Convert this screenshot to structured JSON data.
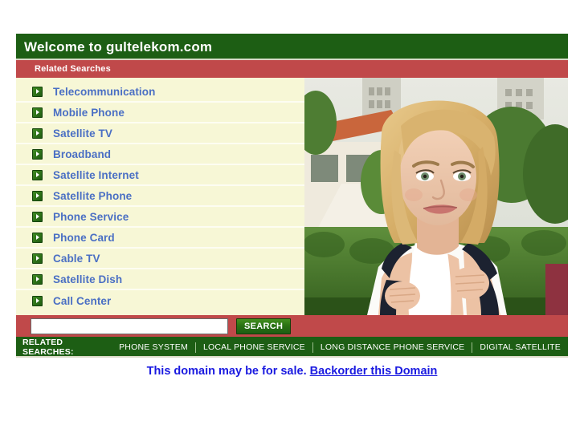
{
  "header": {
    "title": "Welcome to gultelekom.com"
  },
  "subbar": {
    "title": "Related Searches"
  },
  "related_links": [
    {
      "label": "Telecommunication",
      "icon": "arrow-right-icon"
    },
    {
      "label": "Mobile Phone",
      "icon": "arrow-right-icon"
    },
    {
      "label": "Satellite TV",
      "icon": "arrow-right-icon"
    },
    {
      "label": "Broadband",
      "icon": "arrow-right-icon"
    },
    {
      "label": "Satellite Internet",
      "icon": "arrow-right-icon"
    },
    {
      "label": "Satellite Phone",
      "icon": "arrow-right-icon"
    },
    {
      "label": "Phone Service",
      "icon": "arrow-right-icon"
    },
    {
      "label": "Phone Card",
      "icon": "arrow-right-icon"
    },
    {
      "label": "Cable TV",
      "icon": "arrow-right-icon"
    },
    {
      "label": "Satellite Dish",
      "icon": "arrow-right-icon"
    },
    {
      "label": "Call Center",
      "icon": "arrow-right-icon"
    }
  ],
  "photo": {
    "alt": "Smiling blonde young woman wearing a backpack outdoors in front of a tiled-roof building"
  },
  "search": {
    "value": "",
    "placeholder": "",
    "button_label": "SEARCH"
  },
  "footer": {
    "label": "RELATED SEARCHES:",
    "items": [
      "PHONE SYSTEM",
      "LOCAL PHONE SERVICE",
      "LONG DISTANCE PHONE SERVICE",
      "DIGITAL SATELLITE"
    ]
  },
  "sale": {
    "text": "This domain may be for sale.",
    "link_label": "Backorder this Domain"
  },
  "colors": {
    "green": "#1d5e14",
    "red": "#c0494a",
    "cream": "#f7f7d6",
    "link_blue": "#4a6fc4",
    "sale_blue": "#1a1ae0"
  }
}
